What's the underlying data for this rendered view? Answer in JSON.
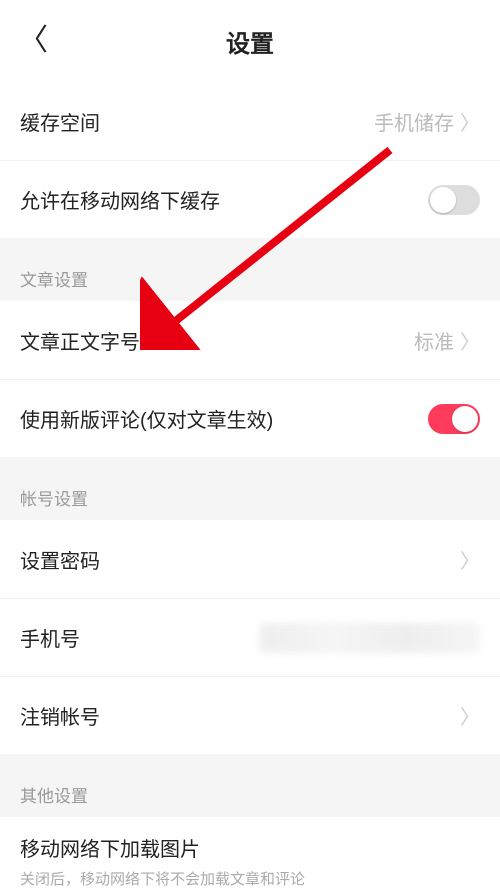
{
  "header": {
    "title": "设置"
  },
  "storage": {
    "cacheSpace": {
      "label": "缓存空间",
      "value": "手机储存"
    },
    "allowCellularCache": {
      "label": "允许在移动网络下缓存"
    }
  },
  "article": {
    "sectionLabel": "文章设置",
    "fontSize": {
      "label": "文章正文字号",
      "value": "标准"
    },
    "newComments": {
      "label": "使用新版评论(仅对文章生效)"
    }
  },
  "account": {
    "sectionLabel": "帐号设置",
    "setPassword": {
      "label": "设置密码"
    },
    "phone": {
      "label": "手机号"
    },
    "deregister": {
      "label": "注销帐号"
    }
  },
  "other": {
    "sectionLabel": "其他设置",
    "loadImagesCellular": {
      "label": "移动网络下加载图片",
      "desc": "关闭后，移动网络下将不会加载文章和评论"
    }
  }
}
